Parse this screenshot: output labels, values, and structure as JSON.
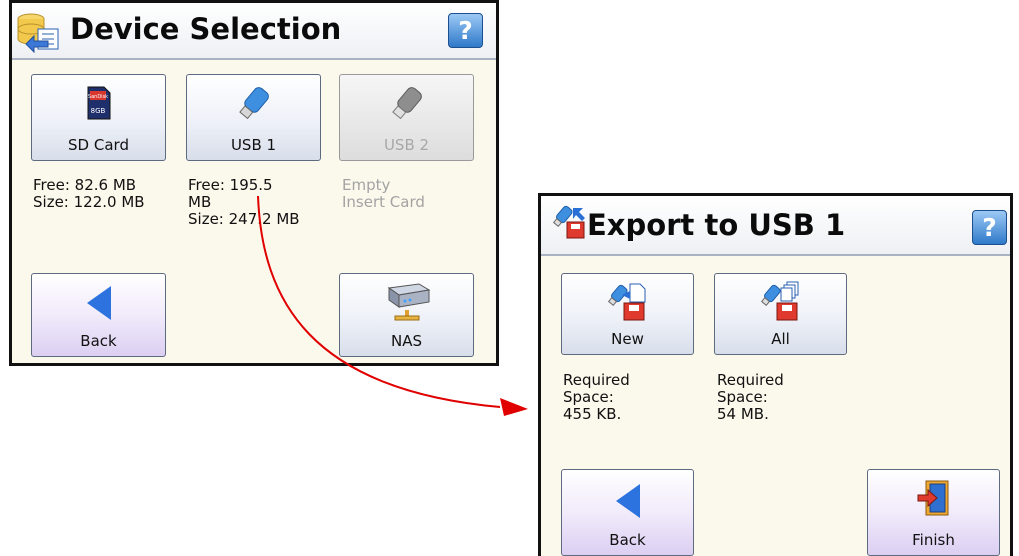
{
  "device_selection": {
    "title": "Device Selection",
    "help": "?",
    "buttons": {
      "sd_card": "SD Card",
      "usb1": "USB 1",
      "usb2": "USB 2",
      "back": "Back",
      "nas": "NAS"
    },
    "info": {
      "sd_card": "Free: 82.6 MB\nSize: 122.0 MB",
      "usb1": "Free: 195.5\nMB\nSize: 247.2 MB",
      "usb2": "Empty\nInsert Card"
    },
    "sd_card_icon_text": {
      "brand": "SanDisk",
      "capacity": "8GB"
    }
  },
  "export_usb": {
    "title": "Export to USB 1",
    "help": "?",
    "buttons": {
      "new": "New",
      "all": "All",
      "back": "Back",
      "finish": "Finish"
    },
    "info": {
      "new": "Required\nSpace:\n455 KB.",
      "all": "Required\nSpace:\n54 MB."
    }
  },
  "colors": {
    "panel_bg": "#fbf8ec",
    "arrow": "#e00000",
    "back_triangle": "#2d73e0",
    "help_blue": "#2f79c9"
  }
}
